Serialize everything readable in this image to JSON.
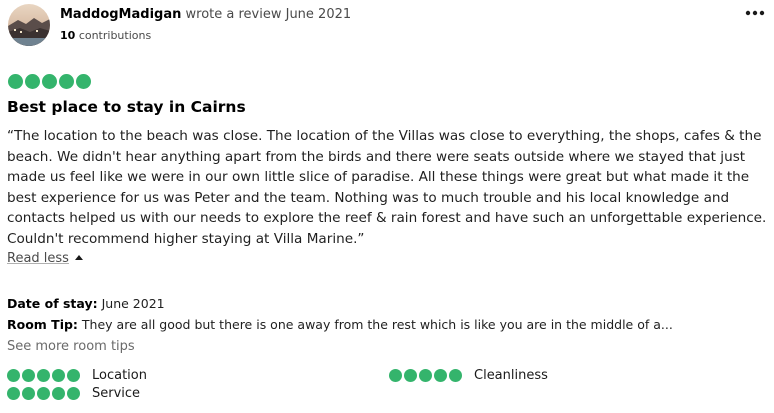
{
  "review": {
    "reviewer_name": "MaddogMadigan",
    "wrote_text": "wrote a review June 2021",
    "contributions_count": "10",
    "contributions_label": "contributions",
    "more_icon": "more-horizontal-icon",
    "rating": 5,
    "rating_max": 5,
    "title": "Best place to stay in Cairns",
    "body": "“The location to the beach was close. The location of the Villas was close to everything, the shops, cafes & the beach. We didn't hear anything apart from the birds and there were seats outside where we stayed that just made us feel like we were in our own little slice of paradise. All these things were great but what made it the best experience for us was Peter and the team. Nothing was to much trouble and his local knowledge and contacts helped us with our needs to explore the reef & rain forest and have such an unforgettable experience. Couldn't recommend higher staying at Villa Marine.”",
    "read_less_label": "Read less",
    "date_of_stay_label": "Date of stay:",
    "date_of_stay_value": "June 2021",
    "room_tip_label": "Room Tip:",
    "room_tip_value": "They are all good but there is one away from the rest which is like you are in the middle of a...",
    "see_more_tips_label": "See more room tips",
    "sub_ratings": [
      {
        "label": "Location",
        "rating": 5
      },
      {
        "label": "Cleanliness",
        "rating": 5
      },
      {
        "label": "Service",
        "rating": 5
      }
    ]
  },
  "colors": {
    "bubble": "#34b46c",
    "text": "#1a1a1a",
    "muted": "#4a4a4a"
  }
}
